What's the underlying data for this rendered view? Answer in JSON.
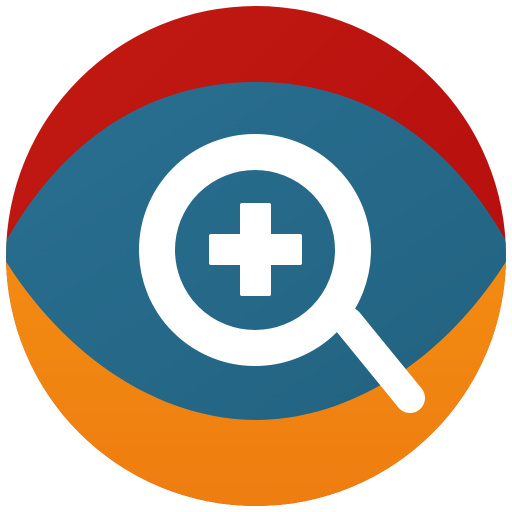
{
  "icon": {
    "semantic": "zoom-in-eye-app-icon",
    "glyph": "magnifier-with-plus",
    "colors": {
      "background": "#ffffff",
      "top_band": "#b30c0c",
      "top_band_light": "#c21a12",
      "bottom_band": "#f38c12",
      "bottom_band_dark": "#ee7d10",
      "eye": "#2a6f92",
      "eye_dark": "#21627f",
      "glyph": "#ffffff"
    }
  }
}
